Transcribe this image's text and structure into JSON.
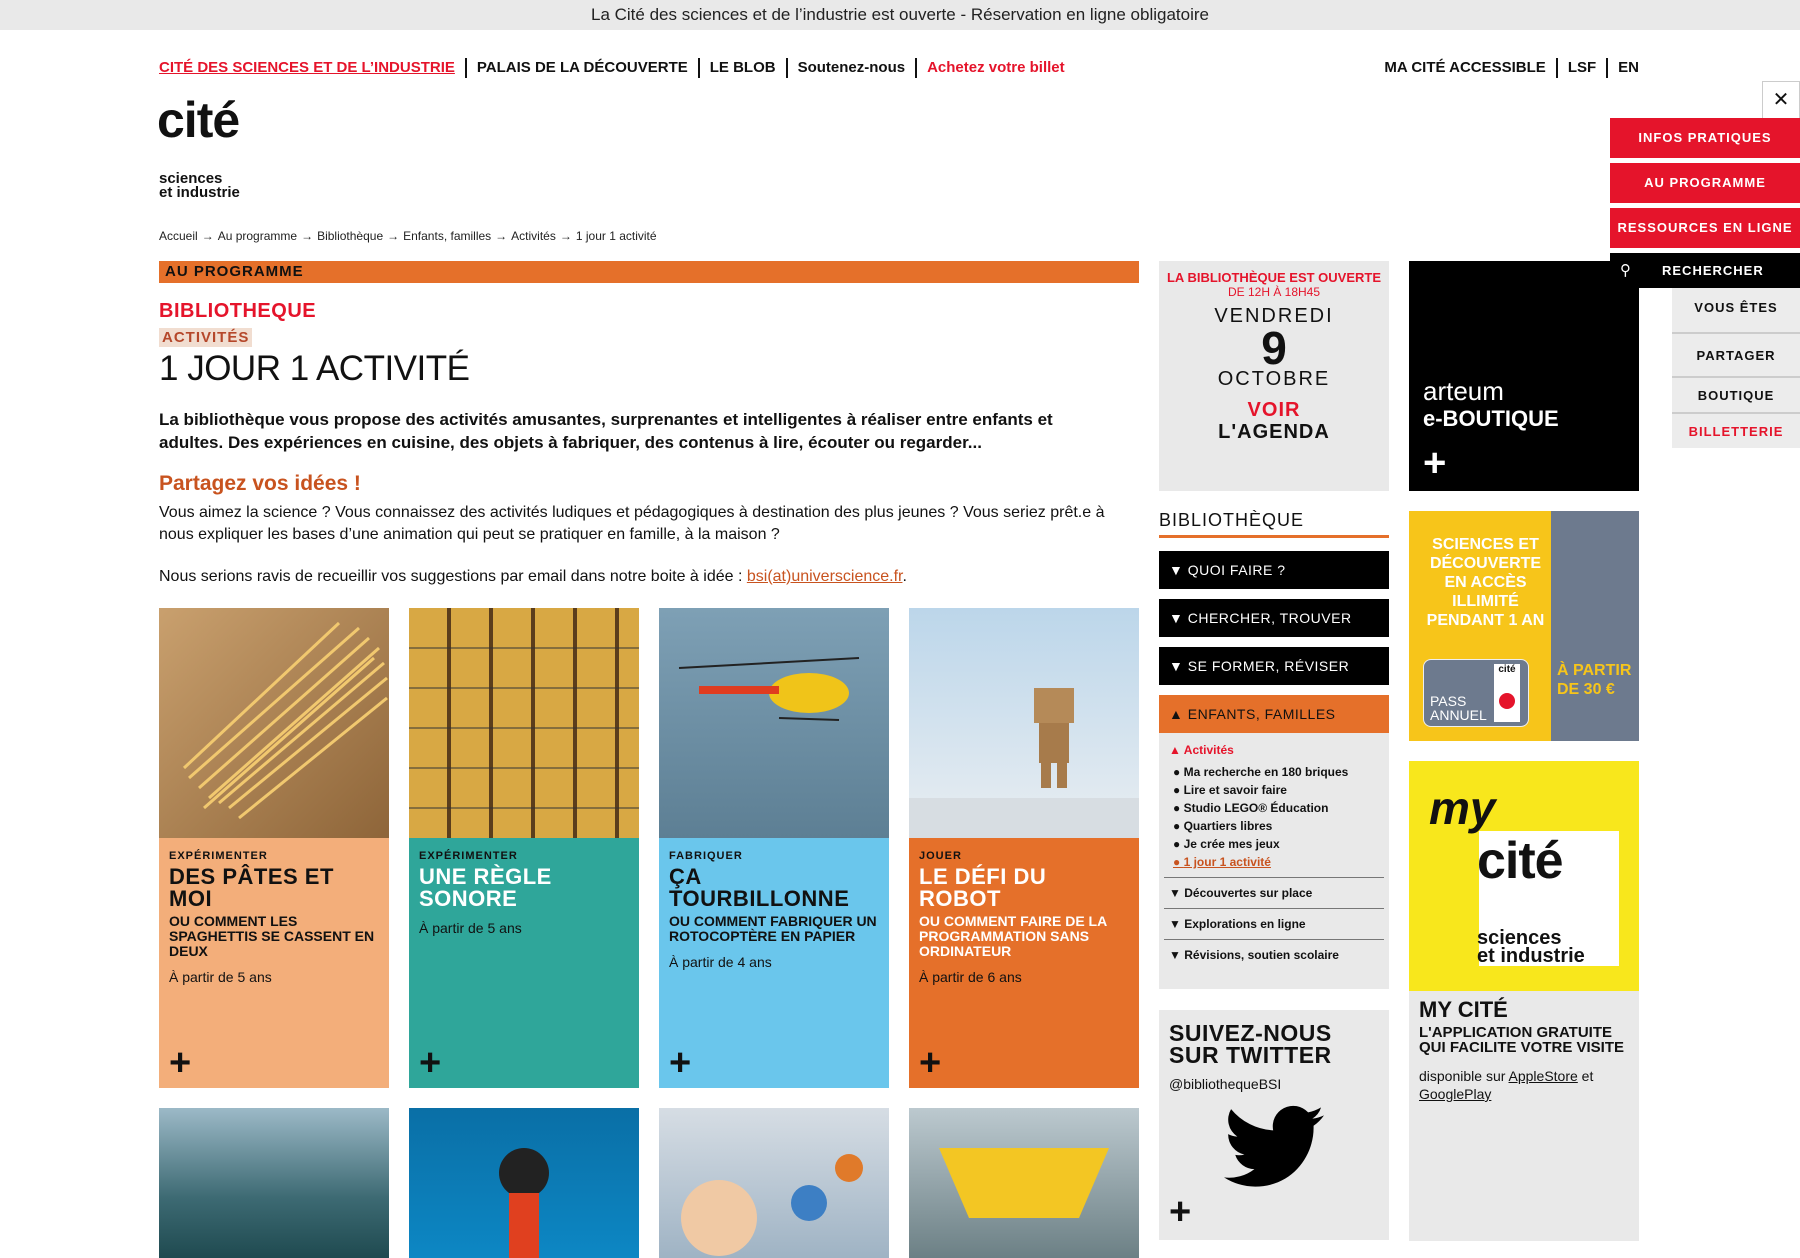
{
  "banner": "La Cité des sciences et de l’industrie est ouverte - Réservation en ligne obligatoire",
  "topnav": [
    "CITÉ DES SCIENCES ET DE L’INDUSTRIE",
    "PALAIS DE LA DÉCOUVERTE",
    "LE BLOB",
    "Soutenez-nous",
    "Achetez votre billet"
  ],
  "rightnav": [
    "MA CITÉ ACCESSIBLE",
    "LSF",
    "EN"
  ],
  "logo": {
    "main": "cité",
    "line1": "sciences",
    "line2": "et industrie"
  },
  "breadcrumb": [
    "Accueil",
    "Au programme",
    "Bibliothèque",
    "Enfants, familles",
    "Activités",
    "1 jour 1 activité"
  ],
  "section_bar": "AU PROGRAMME",
  "kicker": "BIBLIOTHEQUE",
  "tag": "ACTIVITÉS",
  "title": "1 JOUR 1 ACTIVITÉ",
  "lead": "La bibliothèque vous propose des activités amusantes, surprenantes et intelligentes à réaliser entre enfants et adultes. Des expériences en cuisine, des objets à fabriquer, des contenus à lire, écouter ou regarder...",
  "share_title": "Partagez vos idées !",
  "share_text": "Vous aimez la science ? Vous connaissez des activités ludiques et pédagogiques à destination des plus jeunes ? Vous seriez prêt.e à nous expliquer les bases d’une animation qui peut se pratiquer en famille, à la maison ?",
  "suggest_text": "Nous serions ravis de recueillir vos suggestions par email dans notre boite à idée : ",
  "suggest_email": "bsi(at)universcience.fr",
  "suggest_end": ".",
  "cards": [
    {
      "cat": "EXPÉRIMENTER",
      "title": "DES PÂTES ET MOI",
      "sub": "OU COMMENT LES SPAGHETTIS SE CASSENT EN DEUX",
      "age": "À partir de 5 ans",
      "color": "#f3ae7a",
      "plus": "+"
    },
    {
      "cat": "EXPÉRIMENTER",
      "title": "UNE RÈGLE SONORE",
      "sub": "",
      "age": "À partir de 5 ans",
      "color": "#2fa69a",
      "plus": "+"
    },
    {
      "cat": "FABRIQUER",
      "title": "ÇA TOURBILLONNE",
      "sub": "OU COMMENT FABRIQUER UN ROTOCOPTÈRE EN PAPIER",
      "age": "À partir de 4 ans",
      "color": "#6ac6ec",
      "plus": "+"
    },
    {
      "cat": "JOUER",
      "title": "LE DÉFI DU ROBOT",
      "sub": "OU COMMENT FAIRE DE LA PROGRAMMATION SANS ORDINATEUR",
      "age": "À partir de  6 ans",
      "color": "#e5702a",
      "plus": "+"
    }
  ],
  "calendar": {
    "line1": "LA BIBLIOTHÈQUE EST OUVERTE",
    "line2": "DE 12H À 18H45",
    "day": "VENDREDI",
    "num": "9",
    "month": "OCTOBRE",
    "voir": "VOIR",
    "agenda": "L'AGENDA"
  },
  "biblio_heading": "BIBLIOTHÈQUE",
  "accordion": [
    {
      "label": "QUOI FAIRE ?",
      "arrow": "▼"
    },
    {
      "label": "CHERCHER, TROUVER",
      "arrow": "▼"
    },
    {
      "label": "SE FORMER, RÉVISER",
      "arrow": "▼"
    }
  ],
  "accordion_open": {
    "label": "ENFANTS, FAMILLES",
    "arrow": "▲",
    "sub": "Activités",
    "sub_arrow": "▲",
    "items": [
      "Ma recherche en 180 briques",
      "Lire et savoir faire",
      "Studio LEGO® Éducation",
      "Quartiers libres",
      "Je crée mes jeux",
      "1 jour 1 activité"
    ],
    "more": [
      "Découvertes sur place",
      "Explorations en ligne",
      "Révisions, soutien scolaire"
    ],
    "more_arrow": "▼"
  },
  "twitter": {
    "title": "SUIVEZ-NOUS SUR TWITTER",
    "handle": "@bibliothequeBSI",
    "plus": "+"
  },
  "boutique": {
    "brand": "arteum",
    "label": "e-BOUTIQUE",
    "plus": "+"
  },
  "pass": {
    "text": "SCIENCES ET DÉCOUVERTE EN ACCÈS ILLIMITÉ PENDANT 1 AN",
    "price": "À PARTIR DE 30 €",
    "card_top": "cité",
    "card_label": "PASS ANNUEL"
  },
  "mycite": {
    "my": "my",
    "cite": "cité",
    "s1": "sciences",
    "s2": "et industrie",
    "title": "MY CITÉ",
    "sub": "L'APPLICATION GRATUITE QUI FACILITE VOTRE VISITE",
    "avail": "disponible sur ",
    "apple": "AppleStore",
    "and": " et ",
    "google": "GooglePlay"
  },
  "side": {
    "close": "✕",
    "infos": "INFOS PRATIQUES",
    "prog": "AU PROGRAMME",
    "res": "RESSOURCES EN LIGNE",
    "search": "RECHERCHER",
    "vous": "VOUS ÊTES",
    "partager": "PARTAGER",
    "boutique": "BOUTIQUE",
    "billet": "BILLETTERIE"
  },
  "colors": {
    "red": "#e5142b",
    "orange": "#e5702a",
    "yellow": "#f8e71c"
  }
}
